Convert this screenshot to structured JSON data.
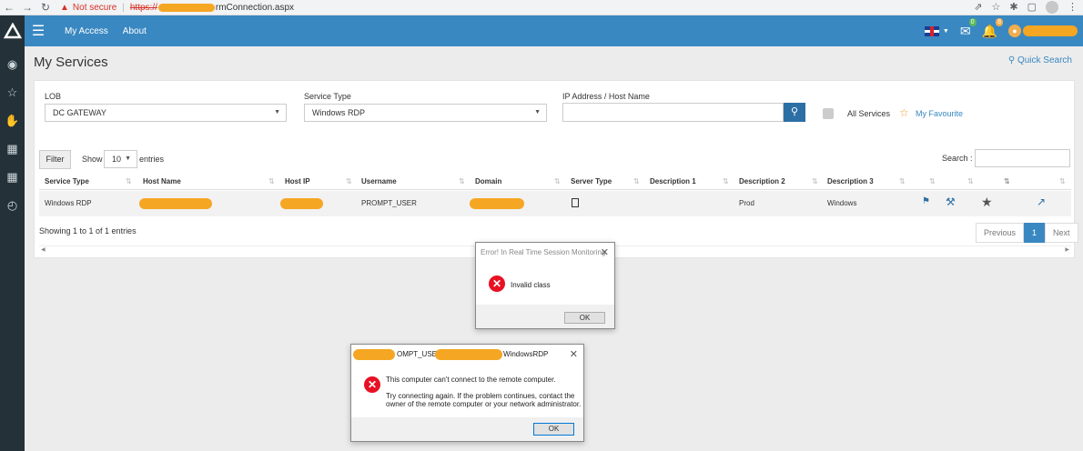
{
  "browser": {
    "warning": "Not secure",
    "separator": "|",
    "url_scheme": "https://",
    "url_rest": "rmConnection.aspx"
  },
  "topbar": {
    "nav": [
      "My Access",
      "About"
    ],
    "mail_badge": "0",
    "bell_badge": "8"
  },
  "page": {
    "title": "My Services",
    "quick_search": "Quick Search"
  },
  "filters": {
    "lob_label": "LOB",
    "lob_value": "DC GATEWAY",
    "service_type_label": "Service Type",
    "service_type_value": "Windows RDP",
    "ip_label": "IP Address / Host Name",
    "all_services": "All Services",
    "my_favourite": "My Favourite"
  },
  "table_controls": {
    "filter": "Filter",
    "show": "Show",
    "entries_value": "10",
    "entries": "entries",
    "search_label": "Search :"
  },
  "table": {
    "headers": [
      "Service Type",
      "Host Name",
      "Host IP",
      "Username",
      "Domain",
      "Server Type",
      "Description 1",
      "Description 2",
      "Description 3"
    ],
    "row": {
      "service_type": "Windows RDP",
      "username": "PROMPT_USER",
      "description2": "Prod",
      "description3": "Windows"
    },
    "showing": "Showing 1 to 1 of 1 entries",
    "pager": [
      "Previous",
      "1",
      "Next"
    ]
  },
  "dialog1": {
    "title": "Error! In Real Time Session Monitoring",
    "message": "Invalid class",
    "ok": "OK"
  },
  "dialog2": {
    "title_a": "OMPT_USER",
    "title_b": "WindowsRDP",
    "line1": "This computer can't connect to the remote computer.",
    "line2": "Try connecting again. If the problem continues, contact the",
    "line3": "owner of the remote computer or your network administrator.",
    "ok": "OK"
  },
  "colors": {
    "accent": "#3a88c1",
    "sidebar": "#243138",
    "redaction": "#f5a623",
    "error": "#e81123"
  }
}
